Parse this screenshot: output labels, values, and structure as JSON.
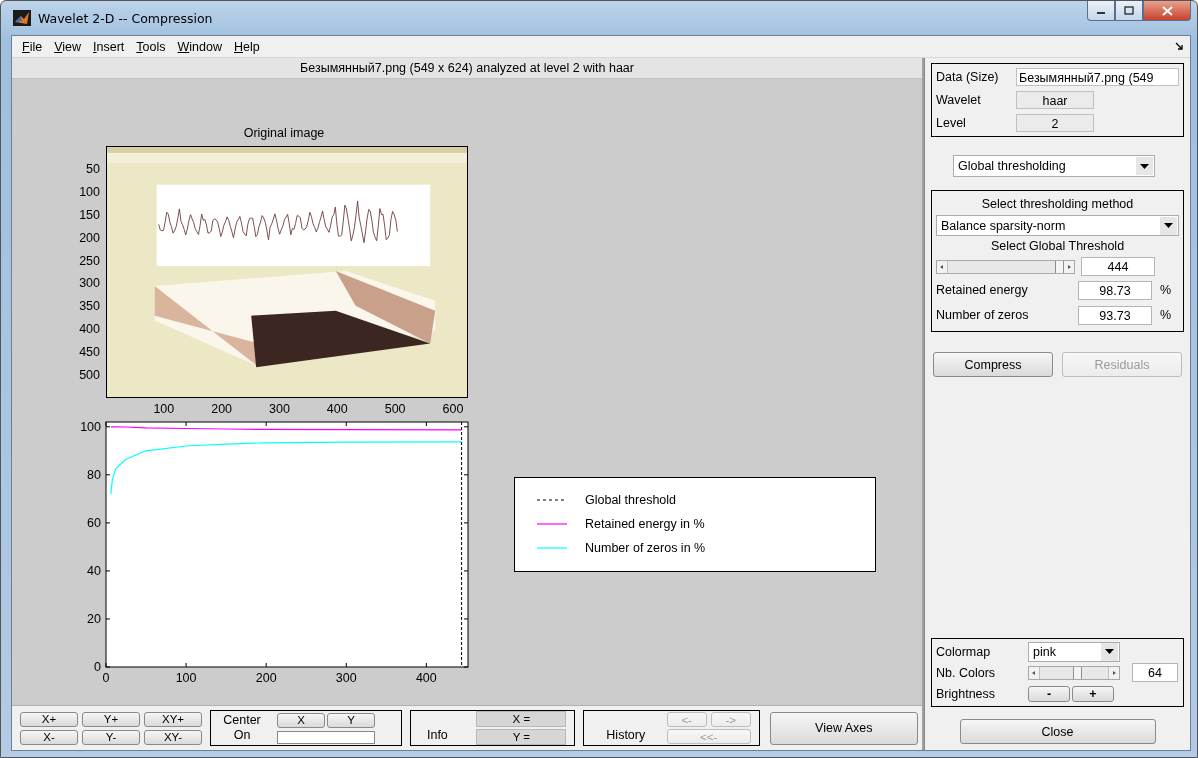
{
  "window": {
    "title": "Wavelet 2-D  --  Compression"
  },
  "menu": [
    "File",
    "View",
    "Insert",
    "Tools",
    "Window",
    "Help"
  ],
  "analysis_caption": "Безымянный7.png (549 x 624) analyzed at level 2 with haar",
  "original_image": {
    "title": "Original image",
    "kind": "picture",
    "yticks": [
      "50",
      "100",
      "150",
      "200",
      "250",
      "300",
      "350",
      "400",
      "450",
      "500"
    ],
    "xticks": [
      "100",
      "200",
      "300",
      "400",
      "500",
      "600"
    ]
  },
  "threshold_chart": {
    "chart_data": {
      "type": "line",
      "x": [
        6,
        8,
        12,
        25,
        50,
        100,
        150,
        200,
        300,
        444
      ],
      "xlim": [
        0,
        452
      ],
      "ylim": [
        0,
        102
      ],
      "xticks": [
        0,
        100,
        200,
        300,
        400
      ],
      "yticks": [
        0,
        20,
        40,
        60,
        80,
        100
      ],
      "series": [
        {
          "name": "Retained energy in %",
          "color": "#ff00ff",
          "values": [
            100,
            100,
            100,
            99.9,
            99.6,
            99.3,
            99.1,
            98.9,
            98.8,
            98.7
          ]
        },
        {
          "name": "Number of zeros in %",
          "color": "#00ffff",
          "values": [
            72,
            78,
            82.5,
            86.5,
            90,
            92,
            92.8,
            93.3,
            93.6,
            93.7
          ]
        }
      ],
      "ref_lines": [
        {
          "axis": "x",
          "value": 444,
          "label": "Global threshold"
        }
      ]
    }
  },
  "info_fields": [
    {
      "label": "Data  (Size)",
      "value": "Безымянный7.png  (549",
      "kind": "text"
    },
    {
      "label": "Wavelet",
      "value": "haar",
      "kind": "readonly"
    },
    {
      "label": "Level",
      "value": "2",
      "kind": "readonly"
    }
  ],
  "mode_select": {
    "value": "Global thresholding"
  },
  "threshold_panel": {
    "method_title": "Select thresholding method",
    "method": "Balance sparsity-norm",
    "threshold_title": "Select Global Threshold",
    "slider": {
      "level": 0.97
    },
    "threshold": "444",
    "readouts": [
      {
        "label": "Retained energy",
        "value": "98.73",
        "unit": "%"
      },
      {
        "label": "Number of zeros",
        "value": "93.73",
        "unit": "%"
      }
    ]
  },
  "actions": [
    {
      "label": "Compress",
      "disabled": false
    },
    {
      "label": "Residuals",
      "disabled": true
    }
  ],
  "display_panel": {
    "colormap_label": "Colormap",
    "colormap": "pink",
    "colors_label": "Nb. Colors",
    "colors_slider": {
      "level": 0.55
    },
    "colors": "64",
    "brightness_label": "Brightness",
    "brightness_buttons": [
      "-",
      "+"
    ]
  },
  "close_button": "Close",
  "toolbar": {
    "zoom_buttons": [
      "X+",
      "Y+",
      "XY+",
      "X-",
      "Y-",
      "XY-"
    ],
    "center": {
      "label": "Center On",
      "buttons": [
        "X",
        "Y"
      ]
    },
    "info": {
      "label": "Info",
      "readouts": [
        "X =",
        "Y ="
      ]
    },
    "history": {
      "label": "History",
      "buttons": [
        {
          "label": "<-",
          "disabled": true
        },
        {
          "label": "->",
          "disabled": true
        },
        {
          "label": "<<-",
          "disabled": true
        }
      ]
    },
    "view_axes": "View Axes"
  }
}
